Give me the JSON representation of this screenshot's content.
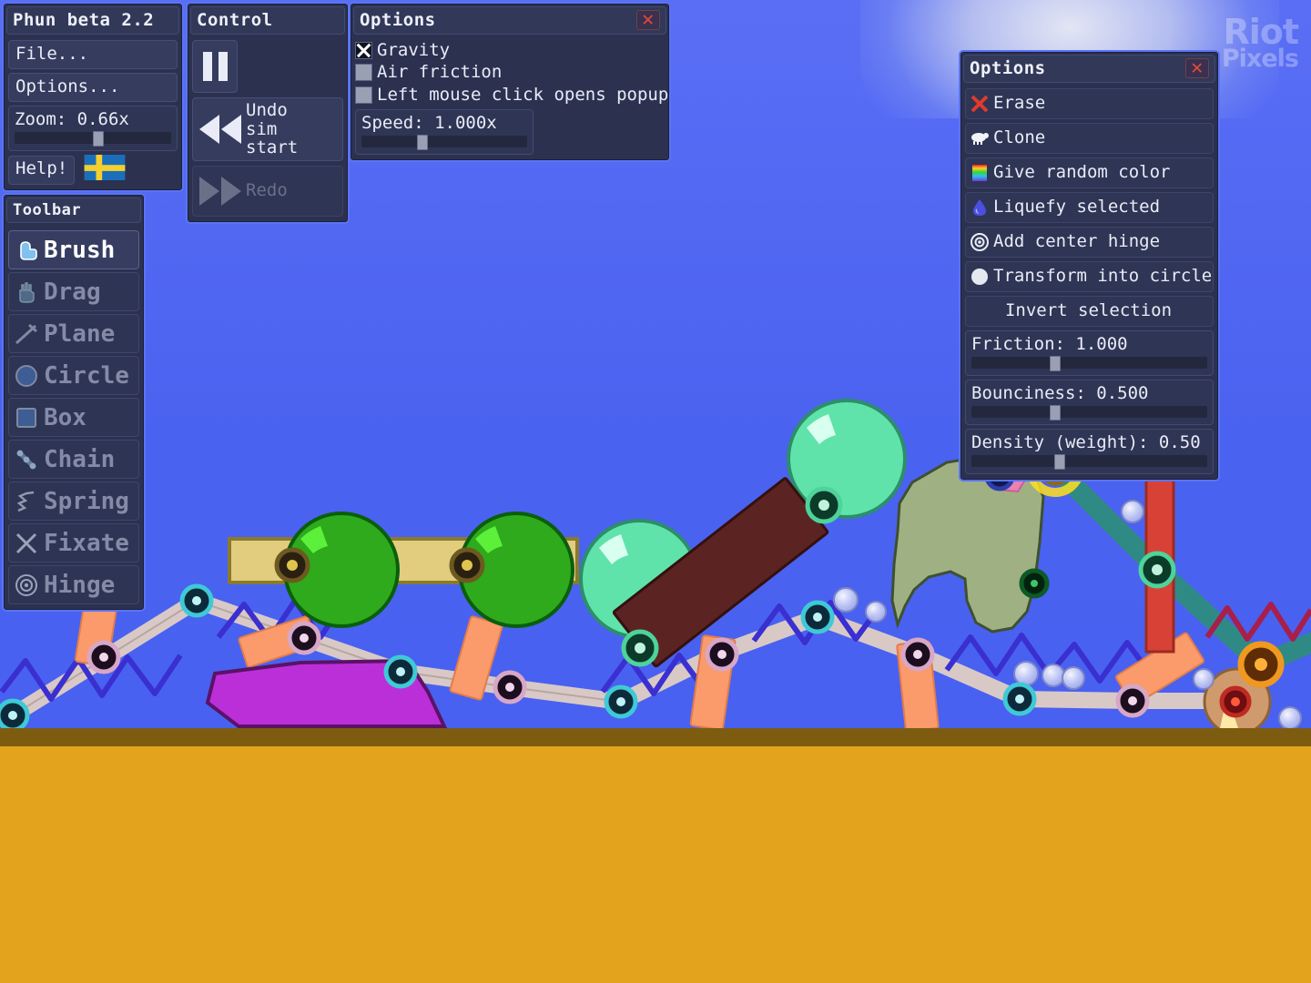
{
  "app": {
    "title": "Phun beta 2.2",
    "watermark_line1": "Riot",
    "watermark_line2": "Pixels"
  },
  "main_panel": {
    "title": "Phun beta 2.2",
    "file_label": "File...",
    "options_label": "Options...",
    "zoom_label": "Zoom: 0.66x",
    "zoom_value": 0.66,
    "zoom_knob_pct": 53,
    "help_label": "Help!",
    "flag_icon": "swedish-flag-icon"
  },
  "control_panel": {
    "title": "Control",
    "pause_icon": "pause-icon",
    "undo_label": "Undo\nsim start",
    "undo_icon": "rewind-icon",
    "redo_label": "Redo",
    "redo_icon": "fast-forward-icon"
  },
  "options_top": {
    "title": "Options",
    "close_icon": "close-icon",
    "checkboxes": [
      {
        "label": "Gravity",
        "checked": true
      },
      {
        "label": "Air friction",
        "checked": false
      },
      {
        "label": "Left mouse click opens popup",
        "checked": false
      }
    ],
    "speed_label": "Speed: 1.000x",
    "speed_value": 1.0,
    "speed_knob_pct": 36
  },
  "toolbar": {
    "title": "Toolbar",
    "items": [
      {
        "label": "Brush",
        "icon": "brush-icon",
        "active": true
      },
      {
        "label": "Drag",
        "icon": "hand-icon",
        "active": false
      },
      {
        "label": "Plane",
        "icon": "plane-icon",
        "active": false
      },
      {
        "label": "Circle",
        "icon": "circle-icon",
        "active": false
      },
      {
        "label": "Box",
        "icon": "box-icon",
        "active": false
      },
      {
        "label": "Chain",
        "icon": "chain-icon",
        "active": false
      },
      {
        "label": "Spring",
        "icon": "spring-icon",
        "active": false
      },
      {
        "label": "Fixate",
        "icon": "fixate-icon",
        "active": false
      },
      {
        "label": "Hinge",
        "icon": "hinge-icon",
        "active": false
      }
    ]
  },
  "options_right": {
    "title": "Options",
    "close_icon": "close-icon",
    "actions": [
      {
        "label": "Erase",
        "icon": "red-x-icon"
      },
      {
        "label": "Clone",
        "icon": "sheep-icon"
      },
      {
        "label": "Give random color",
        "icon": "rainbow-icon"
      },
      {
        "label": "Liquefy selected",
        "icon": "water-drop-icon"
      },
      {
        "label": "Add center hinge",
        "icon": "hinge-target-icon"
      },
      {
        "label": "Transform into circle",
        "icon": "white-circle-icon"
      },
      {
        "label": "Invert selection",
        "icon": "none"
      }
    ],
    "sliders": [
      {
        "label": "Friction: 1.000",
        "value": 1.0,
        "knob_pct": 35
      },
      {
        "label": "Bounciness: 0.500",
        "value": 0.5,
        "knob_pct": 35
      },
      {
        "label": "Density (weight): 0.50",
        "value": 0.5,
        "knob_pct": 37
      }
    ]
  },
  "scene": {
    "sky_color": "#4f66f2",
    "ground_color": "#e3a31c",
    "ground_edge_color": "#7d5c10",
    "objects_note": "physics sandbox: chains, springs, hinges, planks, circles, polygons"
  }
}
